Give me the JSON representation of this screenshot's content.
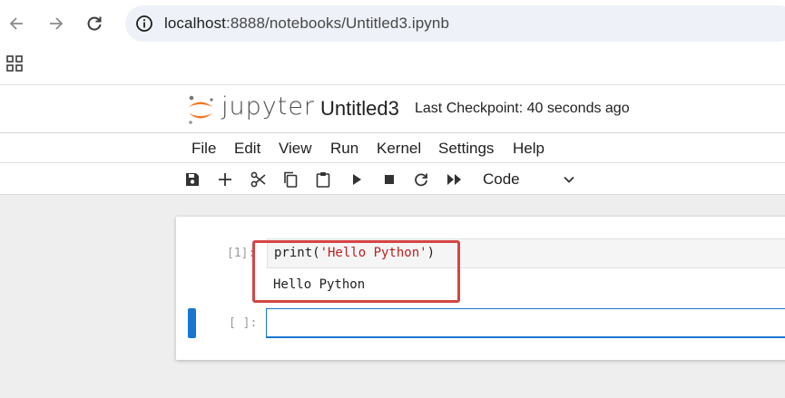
{
  "browser": {
    "url_host": "localhost",
    "url_path": ":8888/notebooks/Untitled3.ipynb",
    "icons": [
      "back-arrow-icon",
      "forward-arrow-icon",
      "reload-icon",
      "site-info-icon",
      "apps-grid-icon"
    ]
  },
  "header": {
    "brand": "jupyter",
    "notebook_title": "Untitled3",
    "checkpoint": "Last Checkpoint: 40 seconds ago"
  },
  "menu": {
    "items": [
      "File",
      "Edit",
      "View",
      "Run",
      "Kernel",
      "Settings",
      "Help"
    ]
  },
  "toolbar": {
    "icons": [
      "save-icon",
      "add-cell-icon",
      "cut-icon",
      "copy-icon",
      "paste-icon",
      "run-icon",
      "stop-icon",
      "restart-icon",
      "run-all-icon"
    ],
    "cell_type": "Code"
  },
  "cells": {
    "executed": {
      "prompt": "[1]:",
      "code_fn": "print(",
      "code_str": "'Hello Python'",
      "code_end": ")",
      "output": "Hello Python"
    },
    "active": {
      "prompt": "[ ]:"
    }
  },
  "colors": {
    "accent": "#1976d2",
    "highlight": "#d64545",
    "string": "#ba2121",
    "logo_orange": "#f37726"
  }
}
